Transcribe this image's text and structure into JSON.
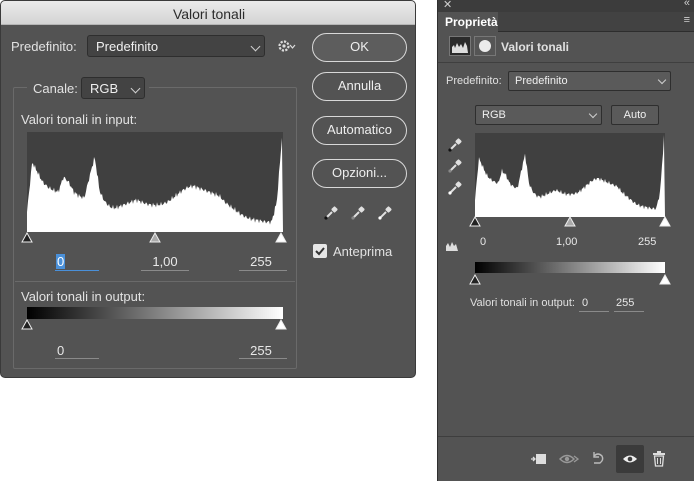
{
  "dialog": {
    "title": "Valori tonali",
    "preset_label": "Predefinito:",
    "preset_value": "Predefinito",
    "channel_label": "Canale:",
    "channel_value": "RGB",
    "input_label": "Valori tonali in input:",
    "input_values": [
      "0",
      "1,00",
      "255"
    ],
    "output_label": "Valori tonali in output:",
    "output_values": [
      "0",
      "255"
    ],
    "buttons": {
      "ok": "OK",
      "cancel": "Annulla",
      "auto": "Automatico",
      "options": "Opzioni..."
    },
    "preview_label": "Anteprima",
    "preview_checked": true
  },
  "panel": {
    "tab_label": "Proprietà",
    "header_title": "Valori tonali",
    "preset_label": "Predefinito:",
    "preset_value": "Predefinito",
    "channel_value": "RGB",
    "auto_label": "Auto",
    "input_values": [
      "0",
      "1,00",
      "255"
    ],
    "output_label": "Valori tonali in output:",
    "output_values": [
      "0",
      "255"
    ]
  },
  "colors": {
    "panel_bg": "#535353",
    "titlebar": "#e0e0e0",
    "accent_focus": "#4a90d9"
  }
}
